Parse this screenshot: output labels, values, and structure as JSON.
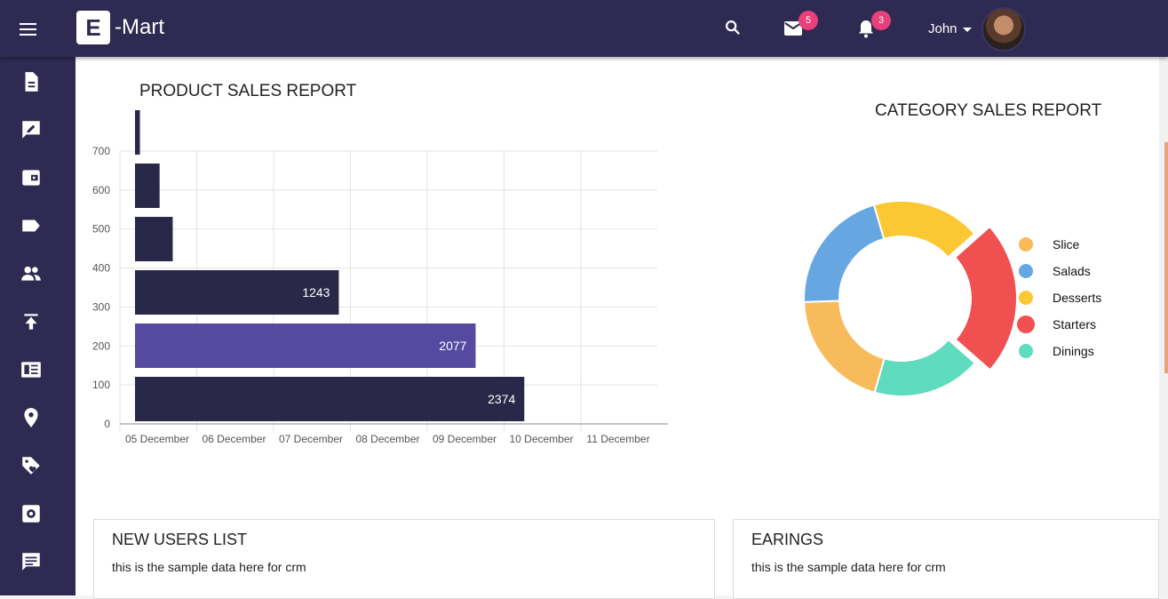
{
  "app": {
    "logo_letter": "E",
    "logo_text": "-Mart"
  },
  "header": {
    "mail_badge": "5",
    "notif_badge": "3",
    "user_name": "John"
  },
  "sidebar": {
    "icons": [
      "document-icon",
      "edit-icon",
      "wallet-icon",
      "tag-icon",
      "users-icon",
      "upload-icon",
      "newspaper-icon",
      "location-pin-icon",
      "tags-icon",
      "settings-icon",
      "chat-icon"
    ]
  },
  "product_report": {
    "title": "PRODUCT SALES REPORT"
  },
  "category_report": {
    "title": "CATEGORY SALES REPORT"
  },
  "cards": {
    "users": {
      "title": "NEW USERS LIST",
      "text": "this is the sample data here for crm"
    },
    "earnings": {
      "title": "EARINGS",
      "text": "this is the sample data here for crm"
    }
  },
  "chart_data": [
    {
      "type": "bar",
      "orientation": "horizontal",
      "title": "PRODUCT SALES REPORT",
      "y_ticks": [
        "700",
        "600",
        "500",
        "400",
        "300",
        "200",
        "100",
        "0"
      ],
      "x_ticks": [
        "05 December",
        "06 December",
        "07 December",
        "08 December",
        "09 December",
        "10 December",
        "11 December"
      ],
      "values": [
        30,
        150,
        230,
        1243,
        2077,
        2374
      ],
      "data_labels": [
        "",
        "",
        "",
        "1243",
        "2077",
        "2374"
      ],
      "bar_colors": [
        "#2a2848",
        "#2a2848",
        "#2a2848",
        "#2a2848",
        "#554aa0",
        "#2a2848"
      ],
      "grid": true
    },
    {
      "type": "pie",
      "variant": "doughnut",
      "title": "CATEGORY SALES REPORT",
      "labels": [
        "Slice",
        "Salads",
        "Desserts",
        "Starters",
        "Dinings"
      ],
      "values": [
        20,
        21,
        18,
        23,
        18
      ],
      "colors": [
        "#f8bb5c",
        "#66a7e2",
        "#fbc733",
        "#f05050",
        "#5fdbbd"
      ],
      "legend": "right"
    }
  ]
}
